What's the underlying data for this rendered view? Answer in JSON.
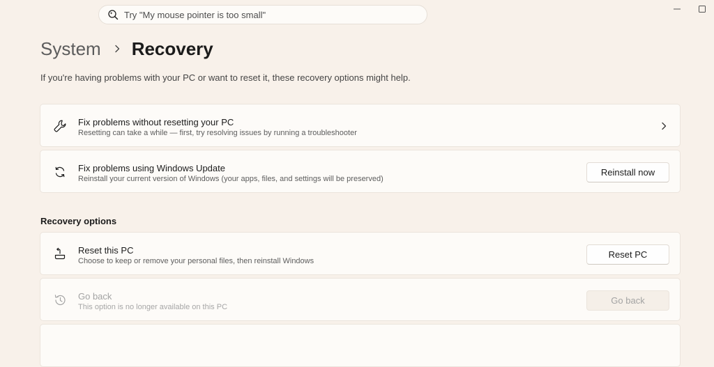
{
  "search": {
    "placeholder": "Try \"My mouse pointer is too small\""
  },
  "breadcrumb": {
    "parent": "System",
    "current": "Recovery"
  },
  "intro_text": "If you're having problems with your PC or want to reset it, these recovery options might help.",
  "cards": [
    {
      "icon": "wrench-icon",
      "title": "Fix problems without resetting your PC",
      "description": "Resetting can take a while — first, try resolving issues by running a troubleshooter"
    },
    {
      "icon": "refresh-icon",
      "title": "Fix problems using Windows Update",
      "description": "Reinstall your current version of Windows (your apps, files, and settings will be preserved)",
      "button": "Reinstall now"
    }
  ],
  "recovery_section": {
    "heading": "Recovery options",
    "items": [
      {
        "icon": "reset-pc-icon",
        "title": "Reset this PC",
        "description": "Choose to keep or remove your personal files, then reinstall Windows",
        "button": "Reset PC"
      },
      {
        "icon": "history-icon",
        "title": "Go back",
        "description": "This option is no longer available on this PC",
        "button": "Go back",
        "enabled": false
      }
    ]
  },
  "colors": {
    "background": "#f8f1ea",
    "card": "#fdfbf8",
    "disabled_text": "#a3a3a3"
  }
}
